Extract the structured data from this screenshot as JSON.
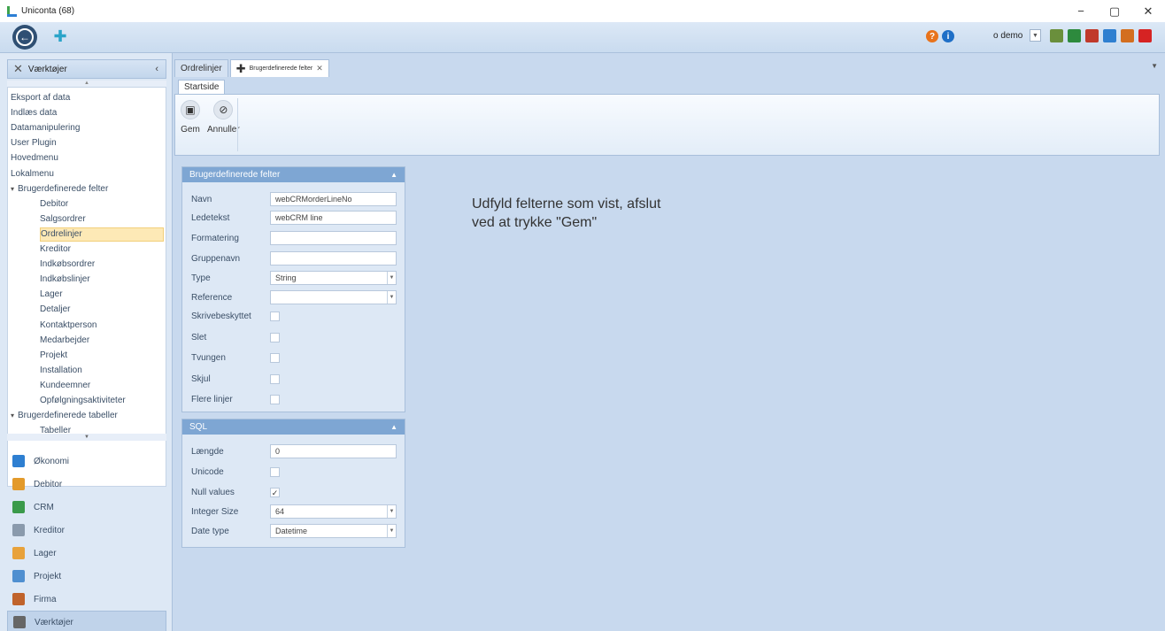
{
  "window": {
    "title": "Uniconta (68)",
    "controls": [
      "−",
      "▢",
      "✕"
    ]
  },
  "toolbar": {
    "user_label": "o demo",
    "help_icon": "?",
    "info_icon": "i",
    "tool_icon_colors": [
      "#6a8f3c",
      "#2d8a3d",
      "#c0392b",
      "#2f7fd0",
      "#d36e1f",
      "#d62323"
    ]
  },
  "sidebar": {
    "header_label": "Værktøjer",
    "collapse_glyph": "‹",
    "tree": [
      {
        "label": "Eksport af data",
        "level": 0
      },
      {
        "label": "Indlæs data",
        "level": 0
      },
      {
        "label": "Datamanipulering",
        "level": 0
      },
      {
        "label": "User Plugin",
        "level": 0
      },
      {
        "label": "Hovedmenu",
        "level": 0
      },
      {
        "label": "Lokalmenu",
        "level": 0
      },
      {
        "label": "Brugerdefinerede felter",
        "level": 0,
        "expanded": true
      },
      {
        "label": "Debitor",
        "level": 1
      },
      {
        "label": "Salgsordrer",
        "level": 1
      },
      {
        "label": "Ordrelinjer",
        "level": 1,
        "selected": true
      },
      {
        "label": "Kreditor",
        "level": 1
      },
      {
        "label": "Indkøbsordrer",
        "level": 1
      },
      {
        "label": "Indkøbslinjer",
        "level": 1
      },
      {
        "label": "Lager",
        "level": 1
      },
      {
        "label": "Detaljer",
        "level": 1
      },
      {
        "label": "Kontaktperson",
        "level": 1
      },
      {
        "label": "Medarbejder",
        "level": 1
      },
      {
        "label": "Projekt",
        "level": 1
      },
      {
        "label": "Installation",
        "level": 1
      },
      {
        "label": "Kundeemner",
        "level": 1
      },
      {
        "label": "Opfølgningsaktiviteter",
        "level": 1
      },
      {
        "label": "Brugerdefinerede tabeller",
        "level": 0,
        "expanded": true
      },
      {
        "label": "Tabeller",
        "level": 1
      }
    ],
    "nav": [
      {
        "label": "Økonomi",
        "color": "#2e7fd1"
      },
      {
        "label": "Debitor",
        "color": "#e39a2b"
      },
      {
        "label": "CRM",
        "color": "#3a9a4a"
      },
      {
        "label": "Kreditor",
        "color": "#8a9aac"
      },
      {
        "label": "Lager",
        "color": "#e8a23b"
      },
      {
        "label": "Projekt",
        "color": "#4f8fd0"
      },
      {
        "label": "Firma",
        "color": "#c0632b"
      },
      {
        "label": "Værktøjer",
        "color": "#666666",
        "active": true
      }
    ]
  },
  "tabs": {
    "tab1": "Ordrelinjer",
    "tab2": "Brugerdefinerede felter"
  },
  "ribbon": {
    "tab": "Startside",
    "save_label": "Gem",
    "cancel_label": "Annuller"
  },
  "panel1": {
    "title": "Brugerdefinerede felter",
    "fields": {
      "navn_label": "Navn",
      "navn_value": "webCRMorderLineNo",
      "ledetekst_label": "Ledetekst",
      "ledetekst_value": "webCRM line",
      "formatering_label": "Formatering",
      "formatering_value": "",
      "gruppenavn_label": "Gruppenavn",
      "gruppenavn_value": "",
      "type_label": "Type",
      "type_value": "String",
      "reference_label": "Reference",
      "reference_value": "",
      "skrivebeskyttet_label": "Skrivebeskyttet",
      "slet_label": "Slet",
      "tvungen_label": "Tvungen",
      "skjul_label": "Skjul",
      "flere_linjer_label": "Flere linjer"
    }
  },
  "panel2": {
    "title": "SQL",
    "fields": {
      "laengde_label": "Længde",
      "laengde_value": "0",
      "unicode_label": "Unicode",
      "null_values_label": "Null values",
      "null_values_check": "✓",
      "integer_size_label": "Integer Size",
      "integer_size_value": "64",
      "date_type_label": "Date type",
      "date_type_value": "Datetime"
    }
  },
  "instruction": {
    "line1": "Udfyld felterne som vist, afslut",
    "line2": "ved at trykke \"Gem\""
  }
}
